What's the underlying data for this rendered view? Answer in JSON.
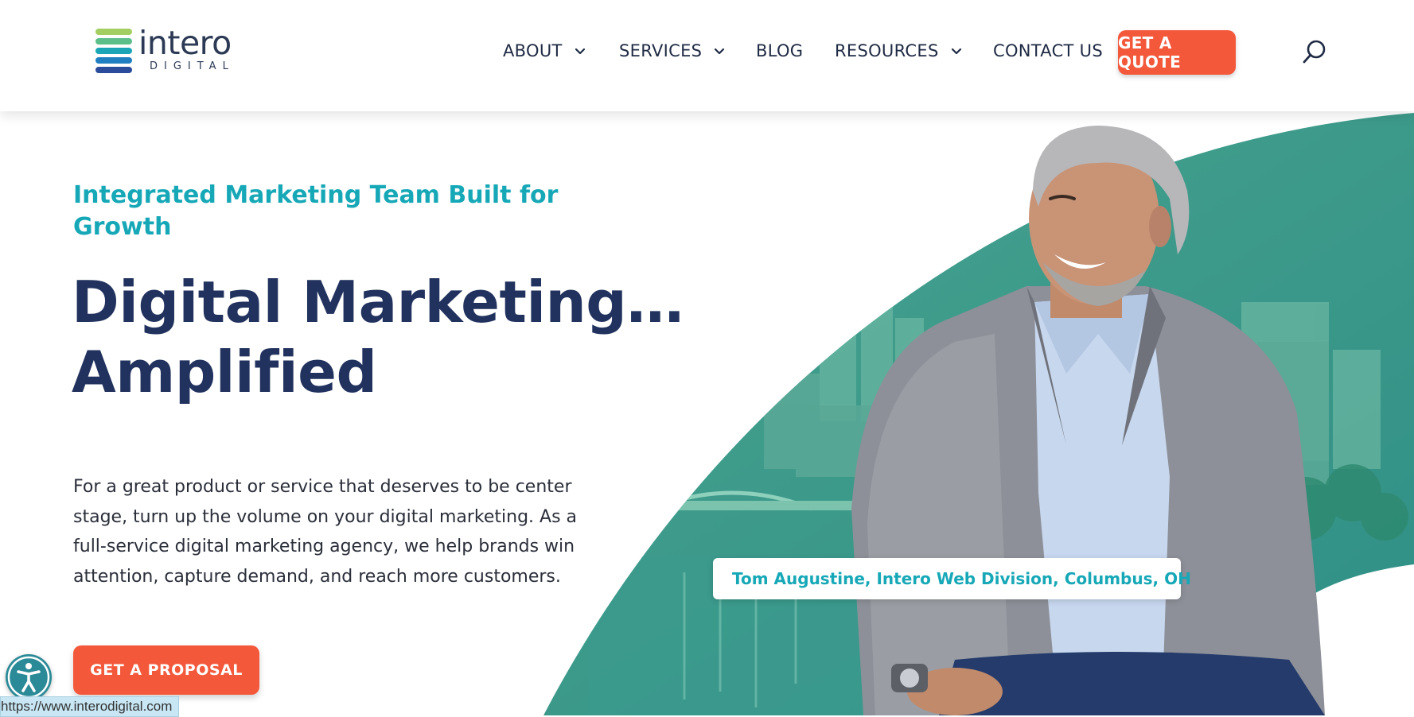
{
  "brand": {
    "name": "intero",
    "sub": "DIGITAL",
    "logo_colors": [
      "#a3cf62",
      "#5cbf8a",
      "#1aa6b7",
      "#1f7fc0",
      "#2a4c9b"
    ]
  },
  "nav": {
    "items": [
      {
        "label": "ABOUT",
        "has_dropdown": true
      },
      {
        "label": "SERVICES",
        "has_dropdown": true
      },
      {
        "label": "BLOG",
        "has_dropdown": false
      },
      {
        "label": "RESOURCES",
        "has_dropdown": true
      },
      {
        "label": "CONTACT US",
        "has_dropdown": false
      }
    ],
    "cta_label": "GET A QUOTE",
    "search_icon": "search-icon"
  },
  "hero": {
    "eyebrow": "Integrated Marketing Team Built for Growth",
    "headline_line1": "Digital Marketing…",
    "headline_line2": "Amplified",
    "lead": "For a great product or service that deserves to be center stage, turn up the volume on your digital marketing. As a full-service digital marketing agency, we help brands win attention, capture demand, and reach more customers.",
    "cta_label": "GET A PROPOSAL",
    "caption": "Tom Augustine, Intero Web Division, Columbus, OH"
  },
  "accessibility": {
    "icon": "accessibility-icon"
  },
  "status_bar": {
    "url": "https://www.interodigital.com"
  },
  "colors": {
    "accent": "#f4583b",
    "teal": "#16a8b7",
    "navy": "#22325e",
    "hero_green": "#3f9a86"
  }
}
